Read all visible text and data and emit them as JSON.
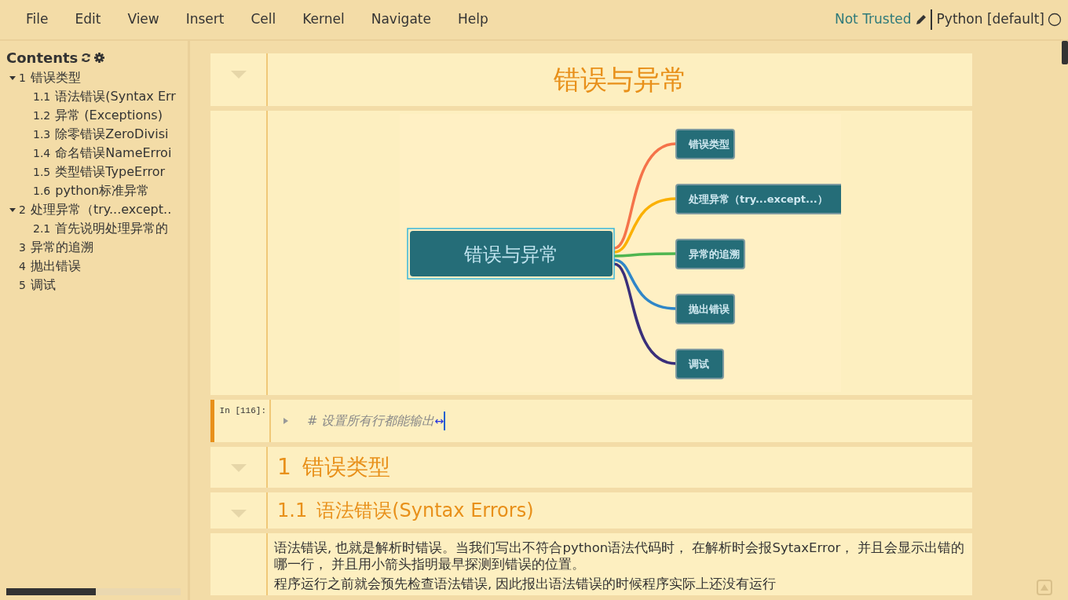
{
  "menu": [
    "File",
    "Edit",
    "View",
    "Insert",
    "Cell",
    "Kernel",
    "Navigate",
    "Help"
  ],
  "header": {
    "trust": "Not Trusted",
    "kernel": "Python [default]"
  },
  "toc": {
    "title": "Contents",
    "items": [
      {
        "number": "1",
        "label": "错误类型",
        "expanded": true,
        "children": [
          {
            "number": "1.1",
            "label": "语法错误(Syntax Err"
          },
          {
            "number": "1.2",
            "label": "异常 (Exceptions)"
          },
          {
            "number": "1.3",
            "label": "除零错误ZeroDivisi"
          },
          {
            "number": "1.4",
            "label": "命名错误NameErroi"
          },
          {
            "number": "1.5",
            "label": "类型错误TypeError"
          },
          {
            "number": "1.6",
            "label": "python标准异常"
          }
        ]
      },
      {
        "number": "2",
        "label": "处理异常（try...except..",
        "expanded": true,
        "children": [
          {
            "number": "2.1",
            "label": "首先说明处理异常的"
          }
        ]
      },
      {
        "number": "3",
        "label": "异常的追溯"
      },
      {
        "number": "4",
        "label": "抛出错误"
      },
      {
        "number": "5",
        "label": "调试"
      }
    ]
  },
  "cells": [
    {
      "kind": "title",
      "text": "错误与异常"
    },
    {
      "kind": "mindmap",
      "root": "错误与异常",
      "branches": [
        {
          "label": "错误类型",
          "color": "#f5734a"
        },
        {
          "label": "处理异常（try...except...）",
          "color": "#fbb000"
        },
        {
          "label": "异常的追溯",
          "color": "#4fb550"
        },
        {
          "label": "抛出错误",
          "color": "#2f86c8"
        },
        {
          "label": "调试",
          "color": "#3a2f7a"
        }
      ]
    },
    {
      "kind": "code",
      "prompt": "In [116]:",
      "code": "# 设置所有行都能输出",
      "fold": "↔",
      "selected": true
    },
    {
      "kind": "heading1",
      "number": "1",
      "text": "错误类型"
    },
    {
      "kind": "heading2",
      "number": "1.1",
      "text": "语法错误(Syntax Errors)"
    },
    {
      "kind": "markdown",
      "paragraphs": [
        "语法错误, 也就是解析时错误。当我们写出不符合python语法代码时， 在解析时会报SytaxError， 并且会显示出错的哪一行， 并且用小箭头指明最早探测到错误的位置。",
        "程序运行之前就会预先检查语法错误, 因此报出语法错误的时候程序实际上还没有运行"
      ]
    }
  ]
}
